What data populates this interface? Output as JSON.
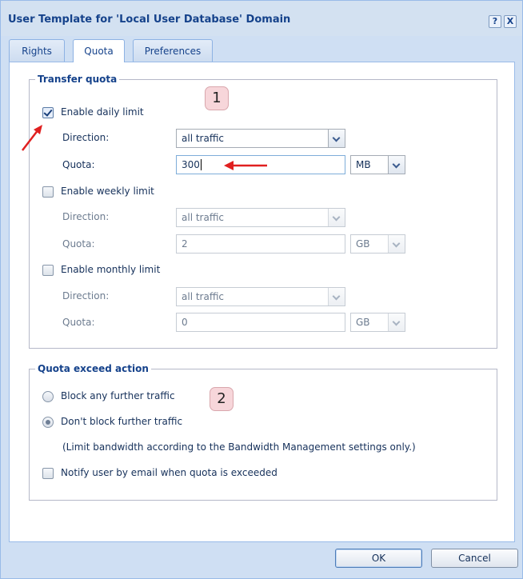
{
  "window": {
    "title": "User Template for 'Local User Database' Domain",
    "help_label": "?",
    "close_label": "X"
  },
  "tabs": [
    {
      "label": "Rights"
    },
    {
      "label": "Quota"
    },
    {
      "label": "Preferences"
    }
  ],
  "active_tab": "Quota",
  "transfer_quota": {
    "legend": "Transfer quota",
    "badge": "1",
    "daily": {
      "checkbox_label": "Enable daily limit",
      "checked": true,
      "direction_label": "Direction:",
      "direction_value": "all traffic",
      "quota_label": "Quota:",
      "quota_value": "300",
      "unit": "MB"
    },
    "weekly": {
      "checkbox_label": "Enable weekly limit",
      "checked": false,
      "direction_label": "Direction:",
      "direction_value": "all traffic",
      "quota_label": "Quota:",
      "quota_value": "2",
      "unit": "GB"
    },
    "monthly": {
      "checkbox_label": "Enable monthly limit",
      "checked": false,
      "direction_label": "Direction:",
      "direction_value": "all traffic",
      "quota_label": "Quota:",
      "quota_value": "0",
      "unit": "GB"
    }
  },
  "exceed_action": {
    "legend": "Quota exceed action",
    "badge": "2",
    "option_block": "Block any further traffic",
    "option_dont_block": "Don't block further traffic",
    "selected": "Don't block further traffic",
    "note": "(Limit bandwidth according to the Bandwidth Management settings only.)",
    "notify_label": "Notify user by email when quota is exceeded",
    "notify_checked": false
  },
  "buttons": {
    "ok": "OK",
    "cancel": "Cancel"
  },
  "colors": {
    "title_text": "#15428b",
    "window_bg": "#cfdff3",
    "annotation_badge": "#f7d6da",
    "annotation_arrow": "#e02020"
  },
  "icons": [
    "help-icon",
    "close-icon",
    "dropdown-arrow-icon",
    "annotation-arrow"
  ]
}
